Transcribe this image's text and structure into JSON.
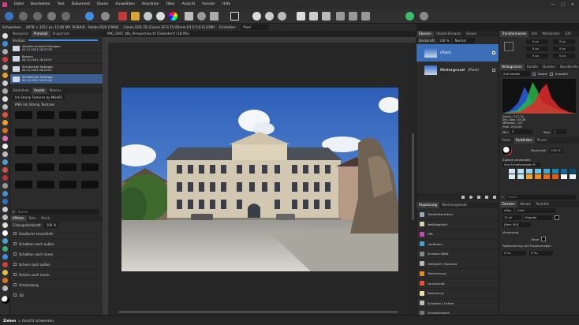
{
  "menu": [
    "Datei",
    "Bearbeiten",
    "Text",
    "Dokument",
    "Ebene",
    "Auswählen",
    "Anordnen",
    "Filter",
    "Ansicht",
    "Fenster",
    "Hilfe"
  ],
  "context_bar": {
    "persona": "Schwenken",
    "doc_info": "4878 × 3252 px, 15,86 MP, RGBA/8 - Adobe RGB (1998)",
    "camera": "Canon EOS 7D (Canon EF-S 15-85mm f/3.5-5.6 IS USM)",
    "units_label": "Einheiten:",
    "units_value": "Pixel"
  },
  "history_panel": {
    "tabs": [
      "Navigator",
      "Protokoll",
      "Snapshots"
    ],
    "active_tab": "Protokoll",
    "position_label": "Position:",
    "entries": [
      {
        "name": "Aktuelle Auswahl festlegen",
        "time": "04.11.2021 18:23:39"
      },
      {
        "name": "Basismi",
        "time": "04.11.2021 18:23:47"
      },
      {
        "name": "Sichtbarkeit festlegen",
        "time": "04.11.2021 18:25:07"
      },
      {
        "name": "Sichtbarkeit festlegen",
        "time": "04.11.2021 18:25:48"
      }
    ]
  },
  "brushes_panel": {
    "tabs": [
      "Bibliothek",
      "Assets",
      "Makros"
    ],
    "category": "Ink Stamp Textures by Mike65",
    "group_title": "PNG Ink Stamp Textures"
  },
  "effects_panel": {
    "search_placeholder": "Suche",
    "tabs": [
      "Effekte",
      "Stile",
      "Stock"
    ],
    "fill_label": "Füllungsdeckkraft:",
    "fill_value": "100 %",
    "effects": [
      "Gaußsche Unschärfe",
      "Schatten nach außen",
      "Schatten nach innen",
      "Schein nach außen",
      "Schein nach innen",
      "Umrandung",
      "3D"
    ]
  },
  "document": {
    "tab_title": "IMG_5007_Nik_Perspective.tif [Geändert] (18,9%)"
  },
  "layers_panel": {
    "tabs": [
      "Ebenen",
      "Objekt-Browser",
      "Stapel"
    ],
    "opacity_label": "Deckkraft:",
    "opacity_value": "100 %",
    "blend_mode": "Normal",
    "layers": [
      {
        "name": "(Pixel)",
        "selected": true
      },
      {
        "name": "Hintergrund",
        "suffix": "(Pixel)",
        "selected": false
      }
    ]
  },
  "adjustments_panel": {
    "tabs": [
      "Anpassung",
      "Werkzeugleiste"
    ],
    "items": [
      {
        "name": "Tonwertkorrektur",
        "color": "#9aa6b2"
      },
      {
        "name": "Weißabgleich",
        "color": "#d8d0b0"
      },
      {
        "name": "HSL",
        "color": "#c04ab0"
      },
      {
        "name": "Umfärben",
        "color": "#4aa0d0"
      },
      {
        "name": "Schwarz-Weiß",
        "color": "#888888"
      },
      {
        "name": "Helligkeit / Kontrast",
        "color": "#b8b8b8"
      },
      {
        "name": "Tontrennung",
        "color": "#e08a2a"
      },
      {
        "name": "Leuchtkraft",
        "color": "#e2523a"
      },
      {
        "name": "Belichtung",
        "color": "#f0e0a0"
      },
      {
        "name": "Schatten / Lichter",
        "color": "#bdbdbd"
      },
      {
        "name": "Schwellenwert",
        "color": "#777777"
      }
    ]
  },
  "transform_panel": {
    "tabs": [
      "Transformieren",
      "Info",
      "Metadaten",
      "33V"
    ],
    "fields": [
      "0 px",
      "0 px",
      "0 px",
      "0 px",
      "0 px",
      "0 px"
    ]
  },
  "histogram_panel": {
    "tabs": [
      "Histogramm",
      "Kanäle",
      "Quellen",
      "Bandbreite"
    ],
    "channel_select": "Alle Kanäle",
    "opt1": "Ebene",
    "opt2": "Auswahl",
    "stats": [
      "Durch.: 127,74",
      "Std. Abw.: 49,36",
      "Mittelwe.: 127",
      "Pixel: 247254"
    ],
    "min_label": "Min:",
    "min_value": "0",
    "max_label": "Max:",
    "max_value": "1"
  },
  "color_panel": {
    "tabs": [
      "Farbe",
      "Farbfelder",
      "Pinsel"
    ],
    "active_tab": "Farbfelder",
    "opacity_label": "Deckkraft:",
    "opacity_value": "100 %",
    "recent_label": "Zuletzt verwendet:",
    "palette_name": "Aha Scharfkantigen M",
    "swatches": [
      "#cde8f4",
      "#b6dff0",
      "#94d0ea",
      "#6bbfe2",
      "#3fa7d4",
      "#1a86b8",
      "#0f6a96",
      "#0a4e72",
      "#d9f0f7",
      "#c2e6f2",
      "#f5a623",
      "#f28b1e",
      "#ee6c12",
      "#e55a0c",
      "#ffffff",
      "#e8f4fa"
    ]
  },
  "char_panel": {
    "search_placeholder": "Suche",
    "tabs": [
      "Zeichen",
      "Absatz",
      "Textstile"
    ],
    "font_family": "Arial",
    "style_label": "Alles",
    "size": "12 pt",
    "weight": "Regular",
    "tracking_label": "[Kein Stil]",
    "section1": "Verzierung",
    "none_label": "Ohne",
    "section2": "Positionierung und Transformation",
    "pos_value": "0 ‰",
    "pos_value2": "0 ‰"
  },
  "status_bar": {
    "bold": "Ziehen",
    "text": "= Ansicht schwenken."
  }
}
